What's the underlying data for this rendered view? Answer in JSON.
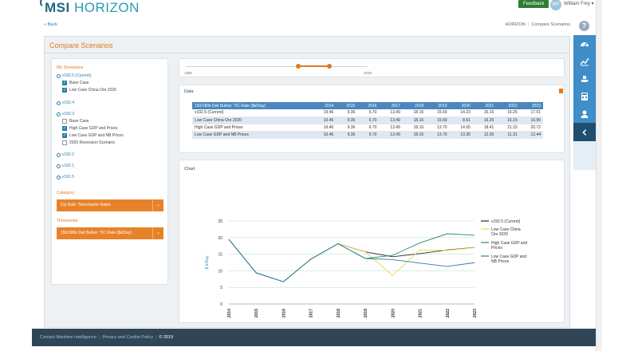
{
  "header": {
    "logo_text_a": "MSI",
    "logo_text_b": "HORIZON",
    "feedback_label": "Feedback",
    "avatar_initials": "WF",
    "user_name": "William Frey ▾"
  },
  "nav": {
    "back_label": "« Back",
    "breadcrumb": [
      "HORIZON",
      "Compare Scenarios"
    ]
  },
  "page": {
    "title": "Compare Scenarios"
  },
  "left_panel": {
    "my_scenarios_label": "My Scenarios",
    "groups": [
      {
        "label": "v192.5 (Current)",
        "items": [
          {
            "label": "Base Case",
            "checked": true
          },
          {
            "label": "Low Case China Ore 2020",
            "checked": true
          }
        ]
      },
      {
        "label": "v192.4",
        "items": []
      },
      {
        "label": "v192.3",
        "items": [
          {
            "label": "Base Case",
            "checked": false
          },
          {
            "label": "High Case GDP and Prices",
            "checked": true
          },
          {
            "label": "Low Case GDP and NB Prices",
            "checked": true
          },
          {
            "label": "2020 Recession Scenario",
            "checked": false
          }
        ]
      },
      {
        "label": "v192.2",
        "items": []
      },
      {
        "label": "v192.1",
        "items": []
      },
      {
        "label": "v191.5",
        "items": []
      }
    ],
    "category_label": "Category",
    "category_value": "Dry Bulk: Timecharter Rates",
    "timeseries_label": "Timeseries",
    "timeseries_value": "150/180k Dwt Bulker: T/C Rate ($k/Day)"
  },
  "slider": {
    "min_label": "1980",
    "max_label": "2035"
  },
  "data_table": {
    "label": "Data",
    "header": [
      "150/180k Dwt Bulker: T/C Rate ($k/Day)",
      "2014",
      "2015",
      "2016",
      "2017",
      "2018",
      "2019",
      "2020",
      "2021",
      "2022",
      "2023"
    ],
    "rows": [
      [
        "v192.5 (Current)",
        "19.46",
        "9.36",
        "6.70",
        "13.49",
        "18.16",
        "15.69",
        "14.23",
        "15.16",
        "16.26",
        "17.01"
      ],
      [
        "Low Case China Ore 2020",
        "19.46",
        "9.36",
        "6.70",
        "13.49",
        "18.16",
        "15.69",
        "8.61",
        "16.26",
        "16.15",
        "16.96"
      ],
      [
        "High Case GDP and Prices",
        "19.46",
        "9.36",
        "6.70",
        "13.49",
        "18.16",
        "13.70",
        "14.65",
        "18.41",
        "21.15",
        "20.72"
      ],
      [
        "Low Case GDP and NB Prices",
        "19.46",
        "9.36",
        "6.70",
        "13.49",
        "18.16",
        "13.70",
        "13.35",
        "12.30",
        "11.31",
        "12.44"
      ]
    ]
  },
  "chart_data": {
    "type": "line",
    "panel_label": "Chart",
    "ylabel": "$ k/Day",
    "ylim": [
      0,
      25
    ],
    "yticks": [
      "0",
      "5",
      "10",
      "15",
      "20",
      "25"
    ],
    "categories": [
      "2014",
      "2015",
      "2016",
      "2017",
      "2018",
      "2019",
      "2020",
      "2021",
      "2022",
      "2023"
    ],
    "grid": true,
    "legend_position": "right",
    "series": [
      {
        "name": "v192.5 (Current)",
        "color": "#2b2b2b",
        "values": [
          19.46,
          9.36,
          6.7,
          13.49,
          18.16,
          15.69,
          14.23,
          15.16,
          16.26,
          17.01
        ]
      },
      {
        "name": "Low Case China Ore 2020",
        "color": "#e9d84a",
        "values": [
          19.46,
          9.36,
          6.7,
          13.49,
          18.16,
          15.69,
          8.61,
          16.26,
          16.15,
          16.96
        ]
      },
      {
        "name": "High Case GDP and Prices",
        "color": "#2e8b6e",
        "values": [
          19.46,
          9.36,
          6.7,
          13.49,
          18.16,
          13.7,
          14.65,
          18.41,
          21.15,
          20.72
        ]
      },
      {
        "name": "Low Case GDP and NB Prices",
        "color": "#2f7d9d",
        "values": [
          19.46,
          9.36,
          6.7,
          13.49,
          18.16,
          13.7,
          13.35,
          12.3,
          11.31,
          12.44
        ]
      }
    ]
  },
  "footer": {
    "link_a": "Contact Maritime Intelligence",
    "link_b": "Privacy and Cookie Policy",
    "copyright": "© 2019"
  },
  "sidebar_icons": [
    "dashboard-icon",
    "chart-icon",
    "ship-icon",
    "calculator-icon",
    "user-icon",
    "collapse-icon"
  ],
  "colors": {
    "accent_orange": "#e07a1f",
    "nav_blue": "#3f8dc9",
    "footer_dark": "#2f4656"
  }
}
